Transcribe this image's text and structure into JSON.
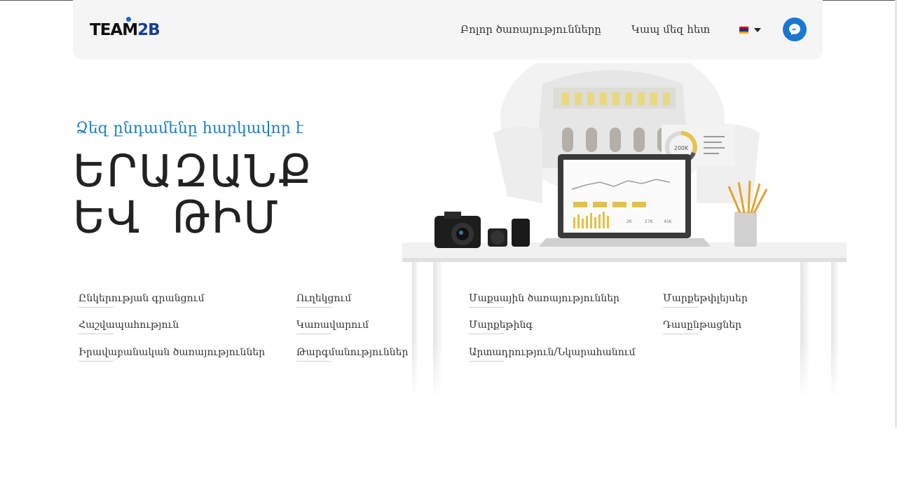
{
  "header": {
    "logo_text_a": "TEAM",
    "logo_text_b": "2B",
    "nav_all_services": "Բոլոր ծառայությունները",
    "nav_contact": "Կապ մեզ հետ",
    "flag_colors": [
      "#d90012",
      "#0033a0",
      "#f2a800"
    ],
    "messenger_color": "#1877d2"
  },
  "hero": {
    "subtitle": "Ձեզ ընդամենը հարկավոր է",
    "title_line1": "ԵՐԱԶԱՆՔ",
    "title_line2": "ԵՎ  ԹԻՄ"
  },
  "services": {
    "col1": [
      "Ընկերության գրանցում",
      "Հաշվապահություն",
      "Իրավաբանական ծառայություններ"
    ],
    "col2": [
      "Ուղեկցում",
      "Կառավարում",
      "Թարգմանություններ"
    ],
    "col3": [
      "Մաքսային ծառայություններ",
      "Մարքեթինգ",
      "Արտադրություն/Նկարահանում"
    ],
    "col4": [
      "Մարքեթփլեյսեր",
      "Դասընթացներ"
    ]
  },
  "illustration": {
    "chart_value": "200K",
    "stat_labels": [
      "2K",
      "27K",
      "45K"
    ]
  }
}
